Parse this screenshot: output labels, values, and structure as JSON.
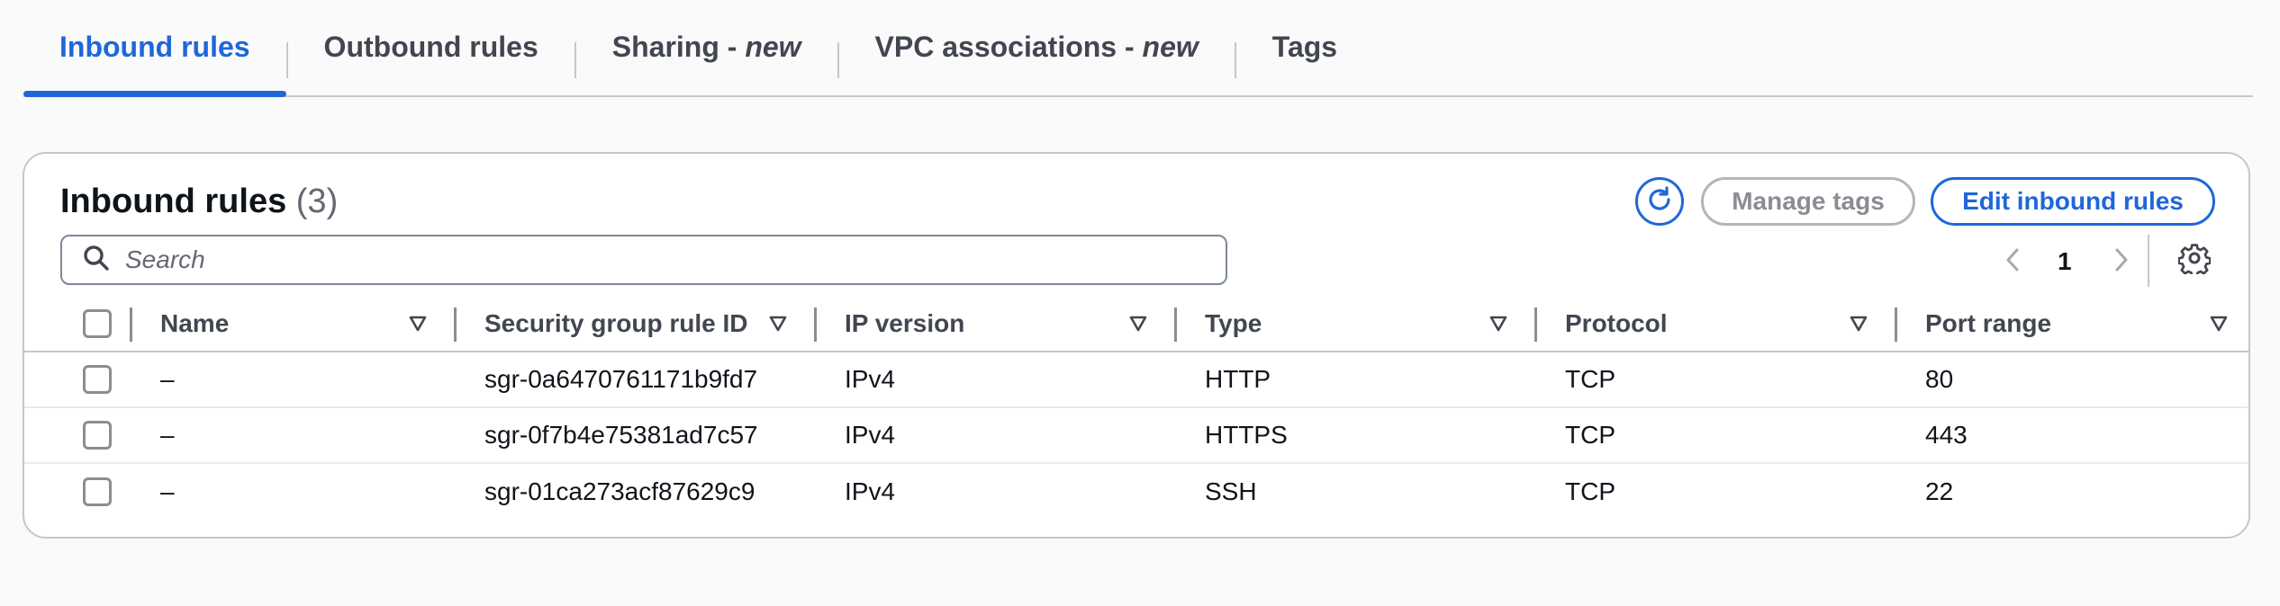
{
  "tabs": [
    {
      "label": "Inbound rules",
      "suffix": ""
    },
    {
      "label": "Outbound rules",
      "suffix": ""
    },
    {
      "label": "Sharing - ",
      "suffix": "new"
    },
    {
      "label": "VPC associations - ",
      "suffix": "new"
    },
    {
      "label": "Tags",
      "suffix": ""
    }
  ],
  "active_tab": "Inbound rules",
  "panel": {
    "title": "Inbound rules",
    "count": "(3)",
    "manage_tags_label": "Manage tags",
    "edit_rules_label": "Edit inbound rules"
  },
  "search": {
    "placeholder": "Search",
    "value": ""
  },
  "pagination": {
    "current_page": "1"
  },
  "table": {
    "columns": [
      "Name",
      "Security group rule ID",
      "IP version",
      "Type",
      "Protocol",
      "Port range"
    ],
    "rows": [
      {
        "name": "–",
        "rule_id": "sgr-0a6470761171b9fd7",
        "ip_version": "IPv4",
        "type": "HTTP",
        "protocol": "TCP",
        "port_range": "80"
      },
      {
        "name": "–",
        "rule_id": "sgr-0f7b4e75381ad7c57",
        "ip_version": "IPv4",
        "type": "HTTPS",
        "protocol": "TCP",
        "port_range": "443"
      },
      {
        "name": "–",
        "rule_id": "sgr-01ca273acf87629c9",
        "ip_version": "IPv4",
        "type": "SSH",
        "protocol": "TCP",
        "port_range": "22"
      }
    ]
  },
  "colors": {
    "accent": "#1f67d8",
    "border": "#c6c6cd",
    "text": "#0f141a"
  }
}
